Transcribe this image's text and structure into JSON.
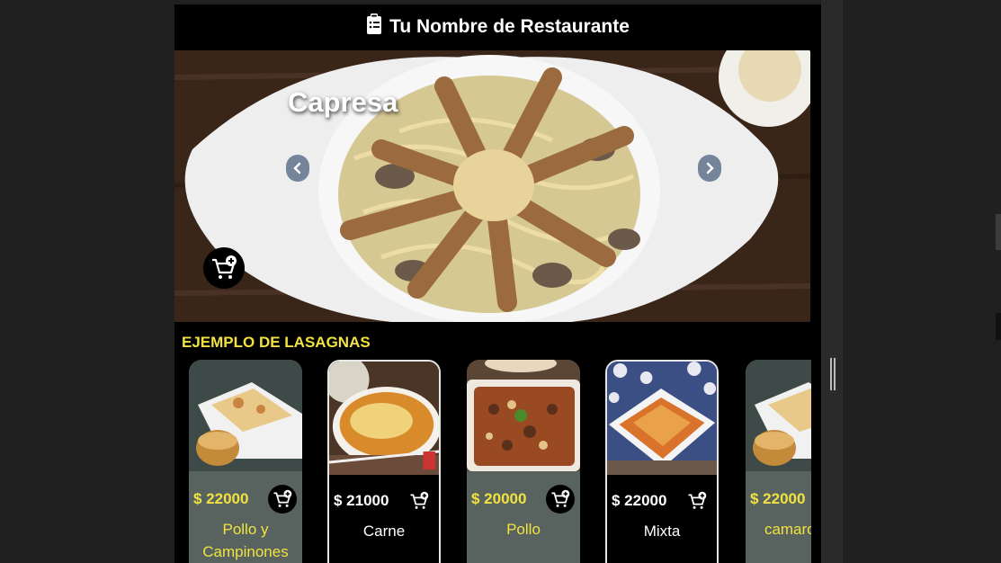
{
  "header": {
    "title": "Tu Nombre de Restaurante",
    "icon": "clipboard-list-icon"
  },
  "hero": {
    "title": "Capresa",
    "prev_icon": "chevron-left-icon",
    "next_icon": "chevron-right-icon",
    "cart_icon": "cart-plus-icon"
  },
  "section": {
    "title": "EJEMPLO DE LASAGNAS"
  },
  "products": [
    {
      "price": "$ 22000",
      "name": "Pollo y Campinones",
      "style": "gray"
    },
    {
      "price": "$ 21000",
      "name": "Carne",
      "style": "dark"
    },
    {
      "price": "$ 20000",
      "name": "Pollo",
      "style": "gray"
    },
    {
      "price": "$ 22000",
      "name": "Mixta",
      "style": "dark"
    },
    {
      "price": "$ 22000",
      "name": "camarones",
      "style": "gray"
    }
  ],
  "colors": {
    "accent": "#f2e23f",
    "card_gray": "#586360",
    "background": "#000000"
  }
}
